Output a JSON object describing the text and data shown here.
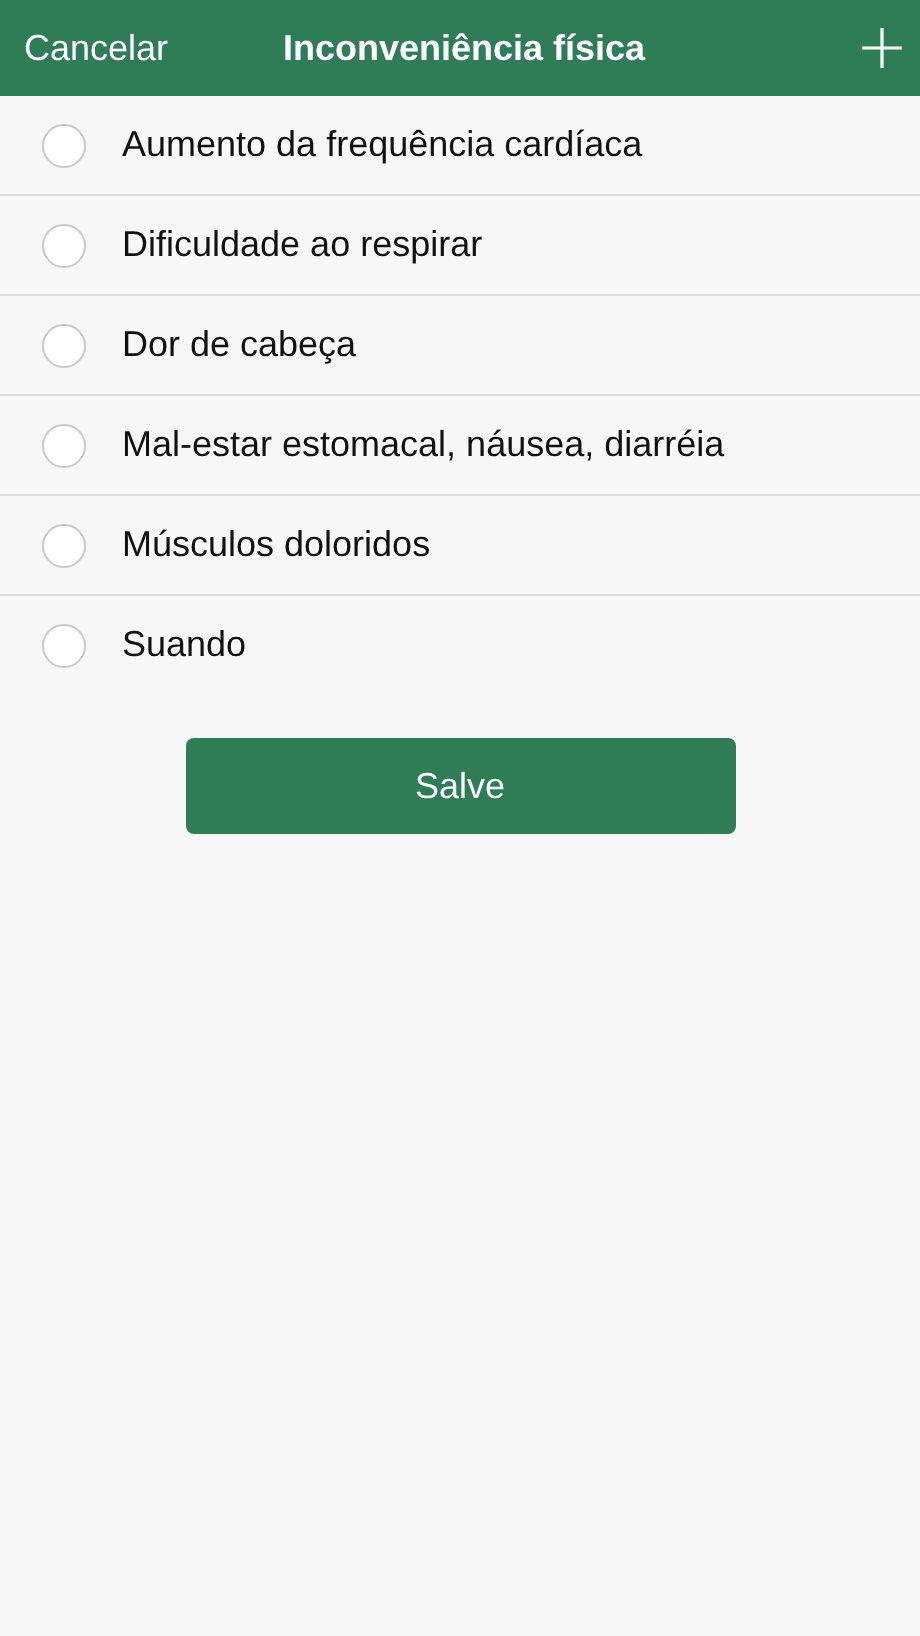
{
  "header": {
    "cancel": "Cancelar",
    "title": "Inconveniência física"
  },
  "options": [
    {
      "label": "Aumento da frequência cardíaca",
      "selected": false
    },
    {
      "label": "Dificuldade ao respirar",
      "selected": false
    },
    {
      "label": "Dor de cabeça",
      "selected": false
    },
    {
      "label": "Mal-estar estomacal, náusea, diarréia",
      "selected": false
    },
    {
      "label": "Músculos doloridos",
      "selected": false
    },
    {
      "label": "Suando",
      "selected": false
    }
  ],
  "save_button": "Salve"
}
